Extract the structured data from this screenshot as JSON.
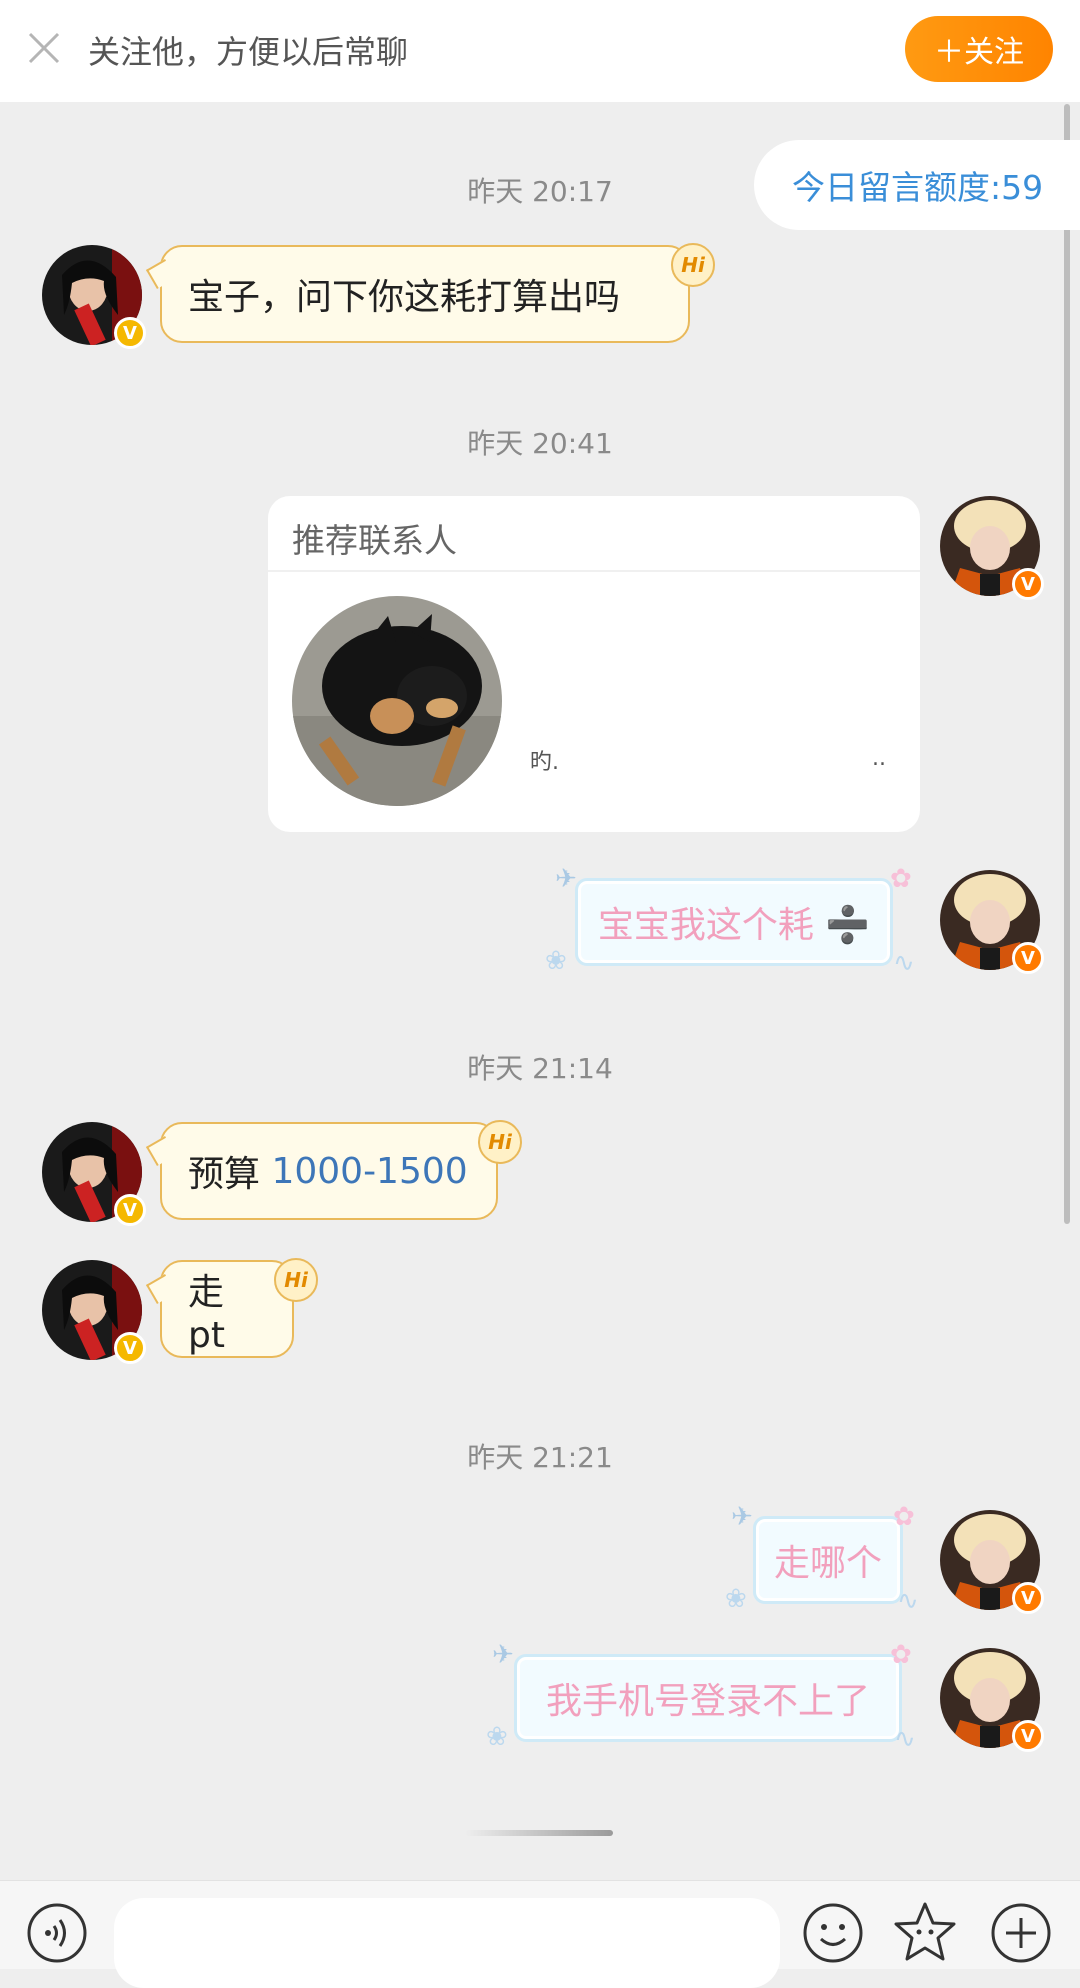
{
  "top_bar": {
    "text": "关注他，方便以后常聊",
    "follow_label": "＋关注"
  },
  "quota": "今日留言额度:59",
  "messages": {
    "t1": "昨天 20:17",
    "m1": "宝子，问下你这耗打算出吗",
    "t2": "昨天 20:41",
    "card_title": "推荐联系人",
    "card_frag1": "旳.",
    "card_frag2": "..",
    "m2": "宝宝我这个耗 ➗",
    "t3": "昨天 21:14",
    "m3_prefix": "预算 ",
    "m3_number": "1000-1500",
    "m4": "走 pt",
    "t4": "昨天 21:21",
    "m5": "走哪个",
    "m6": "我手机号登录不上了"
  },
  "badges": {
    "hi": "Hi",
    "verified": "V"
  },
  "colors": {
    "accent": "#ff8a00",
    "quota_blue": "#3a8ed8",
    "pink_text": "#f2a0bd"
  },
  "icons": [
    "close-icon",
    "voice-icon",
    "emoji-icon",
    "sticker-icon",
    "plus-icon"
  ]
}
